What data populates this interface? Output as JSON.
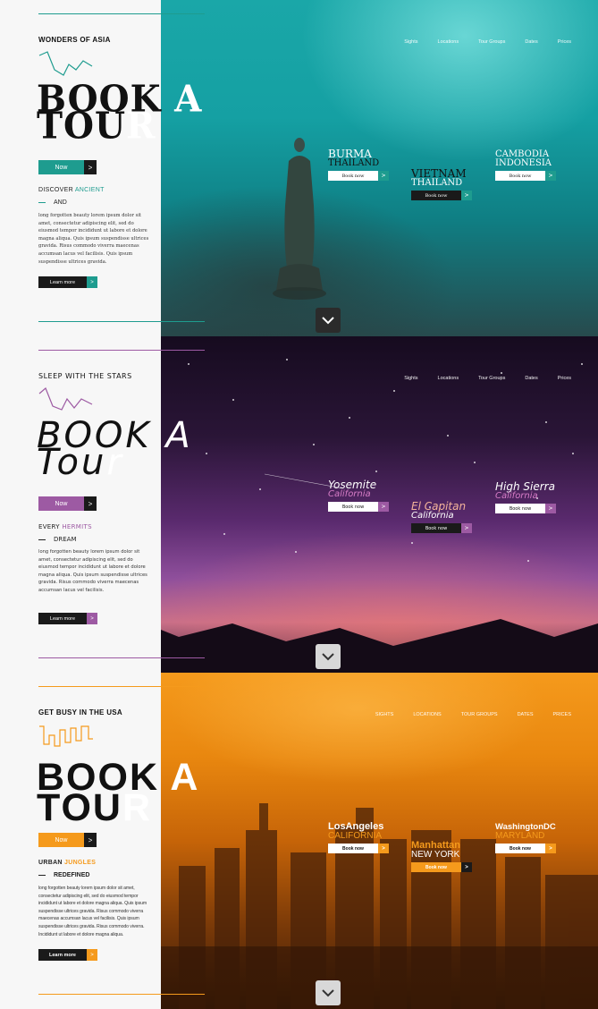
{
  "nav": [
    "Sights",
    "Locations",
    "Tour Groups",
    "Dates",
    "Prices"
  ],
  "nav_upper": [
    "SIGHTS",
    "LOCATIONS",
    "TOUR GROUPS",
    "DATES",
    "PRICES"
  ],
  "colors": {
    "teal": "#1e9c8f",
    "purple": "#9d5aa3",
    "orange": "#f59a1c"
  },
  "sections": [
    {
      "kicker": "WONDERS OF ASIA",
      "title_line1_left": "BOOK",
      "title_line1_right": " A",
      "title_line2_left": "TOU",
      "title_line2_right": "R",
      "now_label": "Now",
      "discover_prefix": "DISCOVER ",
      "discover_accent": "ANCIENT",
      "and_text": "AND",
      "body": "long forgotten beauty lorem ipsum dolor sit amet, consectetur adipiscing elit, sed do eiusmod tempor incididunt ut labore et dolore magna aliqua. Quis ipsum suspendisse ultrices gravida. Risus commodo viverra maecenas accumsan lacus vel facilisis. Quis ipsum suspendisse ultrices gravida.",
      "learn_label": "Learn more",
      "cards": [
        {
          "line1": "BURMA",
          "line2": "THAILAND",
          "button": "Book now"
        },
        {
          "line1": "VIETNAM",
          "line2": "THAILAND",
          "button": "Book now"
        },
        {
          "line1": "CAMBODIA",
          "line2": "INDONESIA",
          "button": "Book now"
        }
      ]
    },
    {
      "kicker": "SLEEP WITH THE STARS",
      "title_line1_left": "BOOK",
      "title_line1_right": " A",
      "title_line2_left": "Tou",
      "title_line2_right": "r",
      "now_label": "Now",
      "discover_prefix": "EVERY ",
      "discover_accent": "HERMITS",
      "and_text": "DREAM",
      "body": "long forgotten beauty lorem ipsum dolor sit amet, consectetur adipiscing elit, sed do eiusmod tempor incididunt ut labore et dolore magna aliqua. Quis ipsum suspendisse ultrices gravida. Risus commodo viverra maecenas accumsan lacus vel facilisis.",
      "learn_label": "Learn more",
      "cards": [
        {
          "line1": "Yosemite",
          "line2": "California",
          "button": "Book now"
        },
        {
          "line1": "El Capitan",
          "line2": "California",
          "button": "Book now"
        },
        {
          "line1": "High Sierra",
          "line2": "California",
          "button": "Book now"
        }
      ]
    },
    {
      "kicker": "GET BUSY IN THE USA",
      "title_line1_left": "BOOK",
      "title_line1_right": " A",
      "title_line2_left": "TOU",
      "title_line2_right": "R",
      "now_label": "Now",
      "discover_prefix": "URBAN ",
      "discover_accent": "JUNGLES",
      "and_text": "REDEFINED",
      "body": "long forgotten beauty lorem ipsum dolor sit amet, consectetur adipiscing elit, sed do eiusmod tempor incididunt ut labore et dolore magna aliqua. Quis ipsum suspendisse ultrices gravida. Risus commodo viverra maecenas accumsan lacus vel facilisis. Quis ipsum suspendisse ultrices gravida. Risus commodo viverra. Incididunt ut labore et dolore magna aliqua.",
      "learn_label": "Learn more",
      "cards": [
        {
          "line1": "LosAngeles",
          "line2": "CALIFORNIA",
          "button": "Book now"
        },
        {
          "line1": "Manhattan",
          "line2": "NEW YORK",
          "button": "Book now"
        },
        {
          "line1": "WashingtonDC",
          "line2": "MARYLAND",
          "button": "Book now"
        }
      ]
    }
  ]
}
